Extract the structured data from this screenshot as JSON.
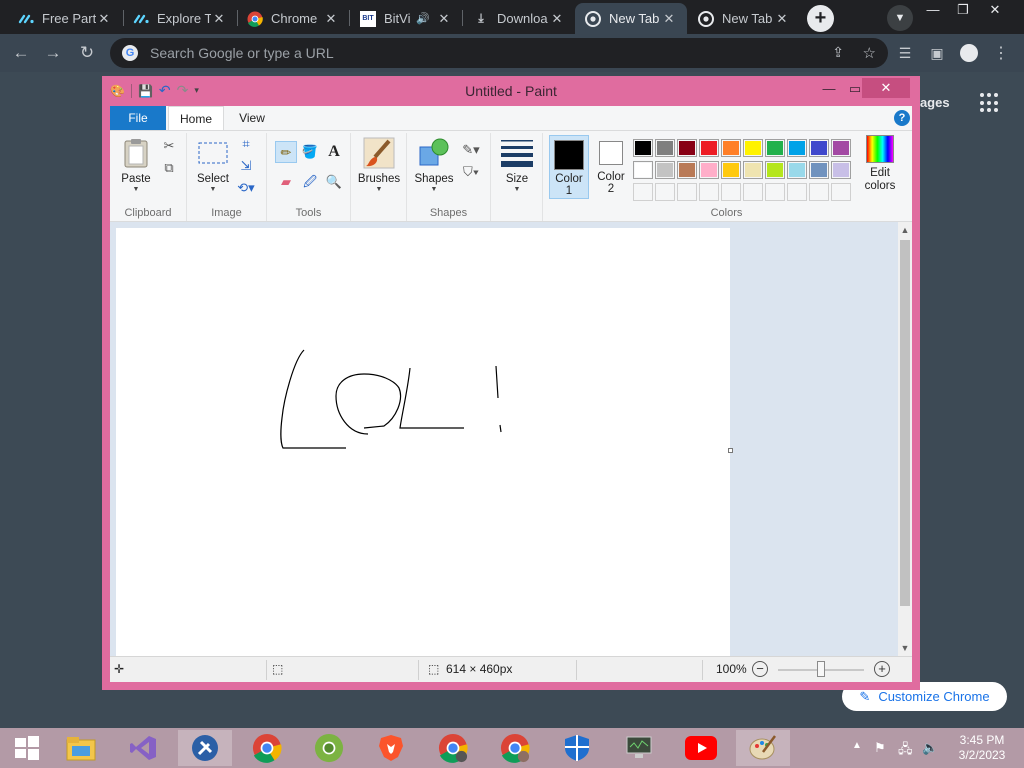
{
  "browser": {
    "tabs": [
      {
        "title": "Free Part",
        "icon": "monday-icon",
        "color": "#5dd5ff"
      },
      {
        "title": "Explore T",
        "icon": "monday-icon",
        "color": "#5dd5ff"
      },
      {
        "title": "Chrome",
        "icon": "chrome-icon",
        "color": "#4285f4"
      },
      {
        "title": "BitVi",
        "icon": "bitview-icon",
        "color": "#ffffff"
      },
      {
        "title": "Downloa",
        "icon": "download-icon",
        "color": "#e8eaed"
      },
      {
        "title": "New Tab",
        "icon": "chrome-icon",
        "color": "#e8eaed"
      },
      {
        "title": "New Tab",
        "icon": "chrome-icon",
        "color": "#e8eaed"
      }
    ],
    "omnibox_placeholder": "Search Google or type a URL",
    "ntp_images_label": "nages",
    "customize_label": "Customize Chrome"
  },
  "paint": {
    "title": "Untitled - Paint",
    "ribbon_tabs": {
      "file": "File",
      "home": "Home",
      "view": "View"
    },
    "groups": {
      "clipboard": "Clipboard",
      "image": "Image",
      "tools": "Tools",
      "shapes": "Shapes",
      "colors": "Colors"
    },
    "buttons": {
      "paste": "Paste",
      "select": "Select",
      "brushes": "Brushes",
      "shapes": "Shapes",
      "size": "Size",
      "color1_line1": "Color",
      "color1_line2": "1",
      "color2_line1": "Color",
      "color2_line2": "2",
      "edit_colors_line1": "Edit",
      "edit_colors_line2": "colors"
    },
    "color1": "#000000",
    "color2": "#ffffff",
    "palette_row1": [
      "#000000",
      "#7f7f7f",
      "#880015",
      "#ed1c24",
      "#ff7f27",
      "#fff200",
      "#22b14c",
      "#00a2e8",
      "#3f48cc",
      "#a349a4"
    ],
    "palette_row2": [
      "#ffffff",
      "#c3c3c3",
      "#b97a57",
      "#ffaec9",
      "#ffc90e",
      "#efe4b0",
      "#b5e61d",
      "#99d9ea",
      "#7092be",
      "#c8bfe7"
    ],
    "status": {
      "dimensions": "614 × 460px",
      "zoom": "100%"
    }
  },
  "taskbar": {
    "apps": [
      "file-explorer-icon",
      "visual-studio-icon",
      "tools-icon",
      "chrome-icon",
      "chrome-canary-icon",
      "brave-icon",
      "chrome-profile-icon",
      "chrome-profile2-icon",
      "defender-icon",
      "monitor-icon",
      "youtube-icon",
      "paint-icon"
    ],
    "time": "3:45 PM",
    "date": "3/2/2023"
  }
}
